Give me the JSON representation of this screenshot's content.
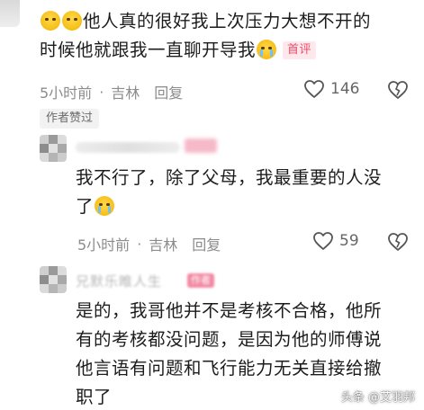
{
  "comments": [
    {
      "text_lines": [
        "他人真的很好我上次压力大想不开的",
        "时候他就跟我一直聊开导我"
      ],
      "badge": "首评",
      "time": "5小时前",
      "location": "吉林",
      "reply_label": "回复",
      "likes": "146",
      "author_liked": "作者赞过"
    },
    {
      "text_lines": [
        "我不行了，除了父母，我最重要的人没",
        "了"
      ],
      "time": "5小时前",
      "location": "吉林",
      "reply_label": "回复",
      "likes": "59"
    },
    {
      "author_name_blurred": "兄默乐睢人生",
      "author_tag_blurred": "作者",
      "text_lines": [
        "是的，我哥他并不是考核不合格，他所",
        "有的考核都没问题，是因为他的师傅说",
        "他言语有问题和飞行能力无关直接给撤",
        "职了"
      ]
    }
  ],
  "watermark": "头条 @艾羽邦",
  "icons": [
    "heart-outline-icon",
    "broken-heart-icon",
    "crying-emoji-icon",
    "pleading-emoji-icon"
  ]
}
